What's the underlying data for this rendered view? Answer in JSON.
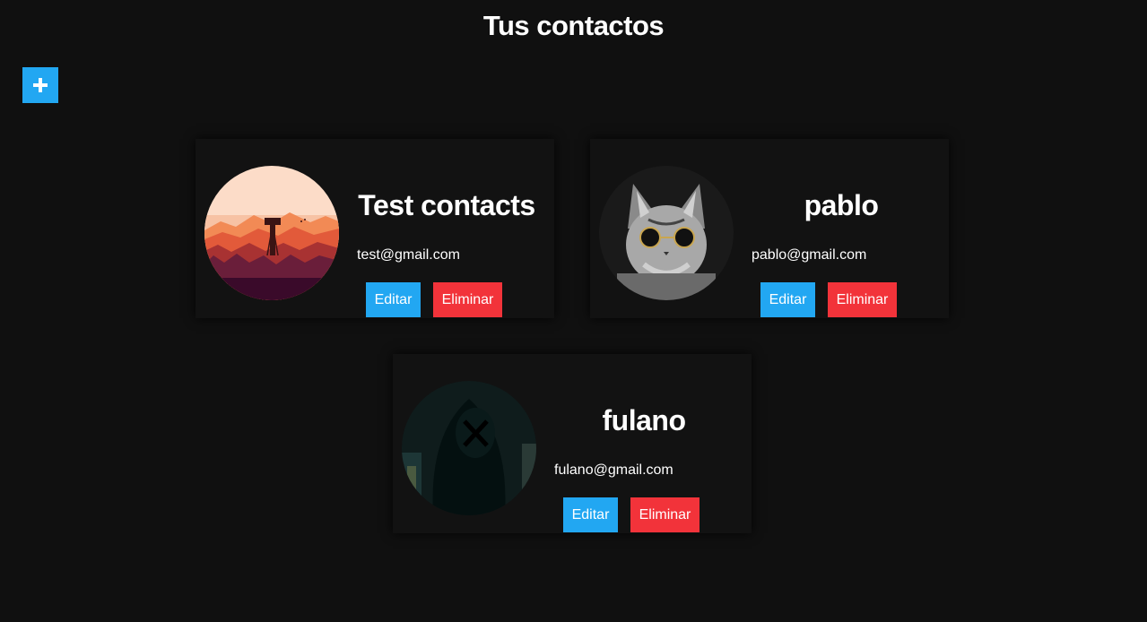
{
  "page": {
    "title": "Tus contactos",
    "add_label": "+"
  },
  "colors": {
    "background": "#101010",
    "card": "#121212",
    "edit_button": "#22a7f2",
    "delete_button": "#f2333a",
    "add_button": "#22a7f2"
  },
  "contacts": [
    {
      "name": "Test contacts",
      "email": "test@gmail.com",
      "avatar_icon": "mountain-landscape-avatar",
      "edit_label": "Editar",
      "delete_label": "Eliminar"
    },
    {
      "name": "pablo",
      "email": "pablo@gmail.com",
      "avatar_icon": "cat-with-sunglasses-avatar",
      "edit_label": "Editar",
      "delete_label": "Eliminar"
    },
    {
      "name": "fulano",
      "email": "fulano@gmail.com",
      "avatar_icon": "hooded-figure-avatar",
      "edit_label": "Editar",
      "delete_label": "Eliminar"
    }
  ]
}
